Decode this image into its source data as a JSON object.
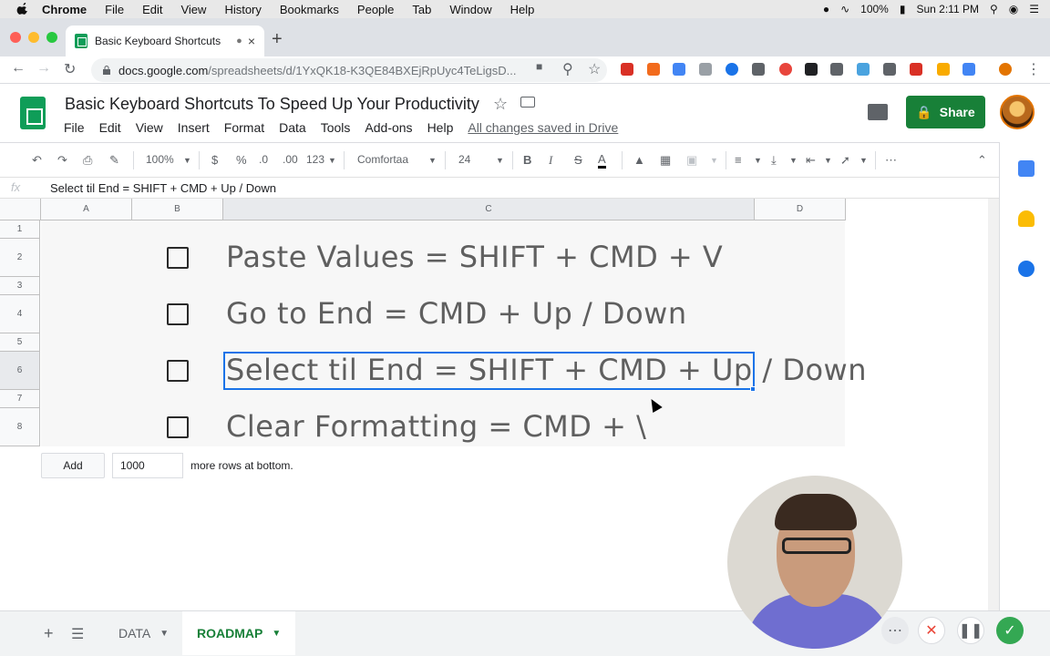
{
  "menubar": {
    "app": "Chrome",
    "items": [
      "File",
      "Edit",
      "View",
      "History",
      "Bookmarks",
      "People",
      "Tab",
      "Window",
      "Help"
    ],
    "battery": "100%",
    "clock": "Sun 2:11 PM"
  },
  "browser": {
    "tab_title": "Basic Keyboard Shortcuts",
    "url_host": "docs.google.com",
    "url_path": "/spreadsheets/d/1YxQK18-K3QE84BXEjRpUyc4TeLigsD..."
  },
  "doc": {
    "title": "Basic Keyboard Shortcuts To Speed Up Your Productivity",
    "menu": [
      "File",
      "Edit",
      "View",
      "Insert",
      "Format",
      "Data",
      "Tools",
      "Add-ons",
      "Help"
    ],
    "save_status": "All changes saved in Drive",
    "share_label": "Share"
  },
  "toolbar": {
    "zoom": "100%",
    "currency": "$",
    "percent": "%",
    "dec_decrease": ".0",
    "dec_increase": ".00",
    "more_formats": "123",
    "font": "Comfortaa",
    "font_size": "24",
    "bold": "B",
    "italic": "I",
    "strike": "S",
    "text_color": "A"
  },
  "formula_bar": {
    "fx": "fx",
    "value": "Select til End = SHIFT + CMD + Up / Down"
  },
  "grid": {
    "columns": [
      "A",
      "B",
      "C",
      "D"
    ],
    "rows": [
      "1",
      "2",
      "3",
      "4",
      "5",
      "6",
      "7",
      "8"
    ],
    "items": [
      {
        "text": "Paste Values = SHIFT + CMD + V"
      },
      {
        "text": "Go to End = CMD + Up / Down"
      },
      {
        "text": "Select til End = SHIFT + CMD + Up / Down"
      },
      {
        "text": "Clear Formatting = CMD + \\"
      }
    ],
    "add_label": "Add",
    "add_count": "1000",
    "add_suffix": "more rows at bottom."
  },
  "sheets": {
    "tabs": [
      "DATA",
      "ROADMAP"
    ],
    "active": "ROADMAP"
  },
  "colors": {
    "share_green": "#188038",
    "selection_blue": "#1a73e8",
    "cell_text": "#5f5f5f"
  }
}
